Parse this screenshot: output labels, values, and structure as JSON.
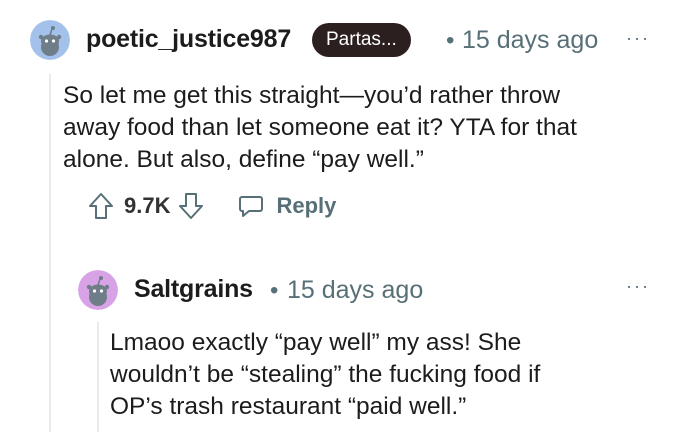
{
  "comment": {
    "username": "poetic_justice987",
    "flair": "Partas...",
    "separator": "•",
    "time": "15 days ago",
    "more": "···",
    "body": [
      "So let me get this straight—you’d rather throw",
      "away food than let someone eat it? YTA for that",
      "alone. But also, define “pay well.”"
    ],
    "votes": "9.7K",
    "reply_label": "Reply",
    "avatar_color": "#a3c1ea"
  },
  "reply": {
    "username": "Saltgrains",
    "separator": "•",
    "time": "15 days ago",
    "more": "···",
    "body": [
      "Lmaoo exactly “pay well” my ass! She",
      "wouldn’t be “stealing” the fucking food if",
      "OP’s trash restaurant “paid well.”"
    ],
    "avatar_color": "#d8a3e6"
  },
  "icons": {
    "upvote": "arrow-up-outline-icon",
    "downvote": "arrow-down-outline-icon",
    "reply": "speech-bubble-icon",
    "more": "ellipsis-icon"
  }
}
